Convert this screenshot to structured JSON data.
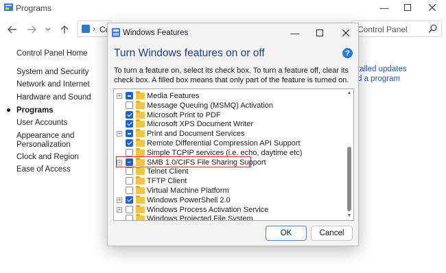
{
  "control_panel": {
    "title": "Programs",
    "address_path": "Co",
    "search_placeholder": "Control Panel",
    "sidebar": [
      {
        "label": "Control Panel Home",
        "active": false
      },
      {
        "label": "System and Security",
        "active": false
      },
      {
        "label": "Network and Internet",
        "active": false
      },
      {
        "label": "Hardware and Sound",
        "active": false
      },
      {
        "label": "Programs",
        "active": true
      },
      {
        "label": "User Accounts",
        "active": false
      },
      {
        "label": "Appearance and",
        "active": false
      },
      {
        "label": "Personalization",
        "active": false
      },
      {
        "label": "Clock and Region",
        "active": false
      },
      {
        "label": "Ease of Access",
        "active": false
      }
    ],
    "right_links": [
      "talled updates",
      "d a program"
    ]
  },
  "dialog": {
    "title": "Windows Features",
    "heading": "Turn Windows features on or off",
    "description": "To turn a feature on, select its check box. To turn a feature off, clear its check box. A filled box means that only part of the feature is turned on.",
    "help_symbol": "?",
    "features": [
      {
        "label": "Media Features",
        "expandable": true,
        "state": "partial"
      },
      {
        "label": "Message Queuing (MSMQ) Activation",
        "expandable": false,
        "state": "unchecked"
      },
      {
        "label": "Microsoft Print to PDF",
        "expandable": false,
        "state": "checked"
      },
      {
        "label": "Microsoft XPS Document Writer",
        "expandable": false,
        "state": "checked"
      },
      {
        "label": "Print and Document Services",
        "expandable": true,
        "state": "partial"
      },
      {
        "label": "Remote Differential Compression API Support",
        "expandable": false,
        "state": "checked"
      },
      {
        "label": "Simple TCPIP services (i.e. echo, daytime etc)",
        "expandable": false,
        "state": "unchecked"
      },
      {
        "label": "SMB 1.0/CIFS File Sharing Support",
        "expandable": true,
        "state": "partial",
        "highlighted": true
      },
      {
        "label": "Telnet Client",
        "expandable": false,
        "state": "unchecked"
      },
      {
        "label": "TFTP Client",
        "expandable": false,
        "state": "unchecked"
      },
      {
        "label": "Virtual Machine Platform",
        "expandable": false,
        "state": "unchecked"
      },
      {
        "label": "Windows PowerShell 2.0",
        "expandable": true,
        "state": "checked"
      },
      {
        "label": "Windows Process Activation Service",
        "expandable": true,
        "state": "unchecked"
      },
      {
        "label": "Windows Projected File System",
        "expandable": false,
        "state": "unchecked"
      }
    ],
    "ok_label": "OK",
    "cancel_label": "Cancel"
  },
  "colors": {
    "heading": "#1a3e8a",
    "checkbox_accent": "#1e64c8",
    "highlight_border": "#d32626",
    "link": "#1b56b8"
  }
}
